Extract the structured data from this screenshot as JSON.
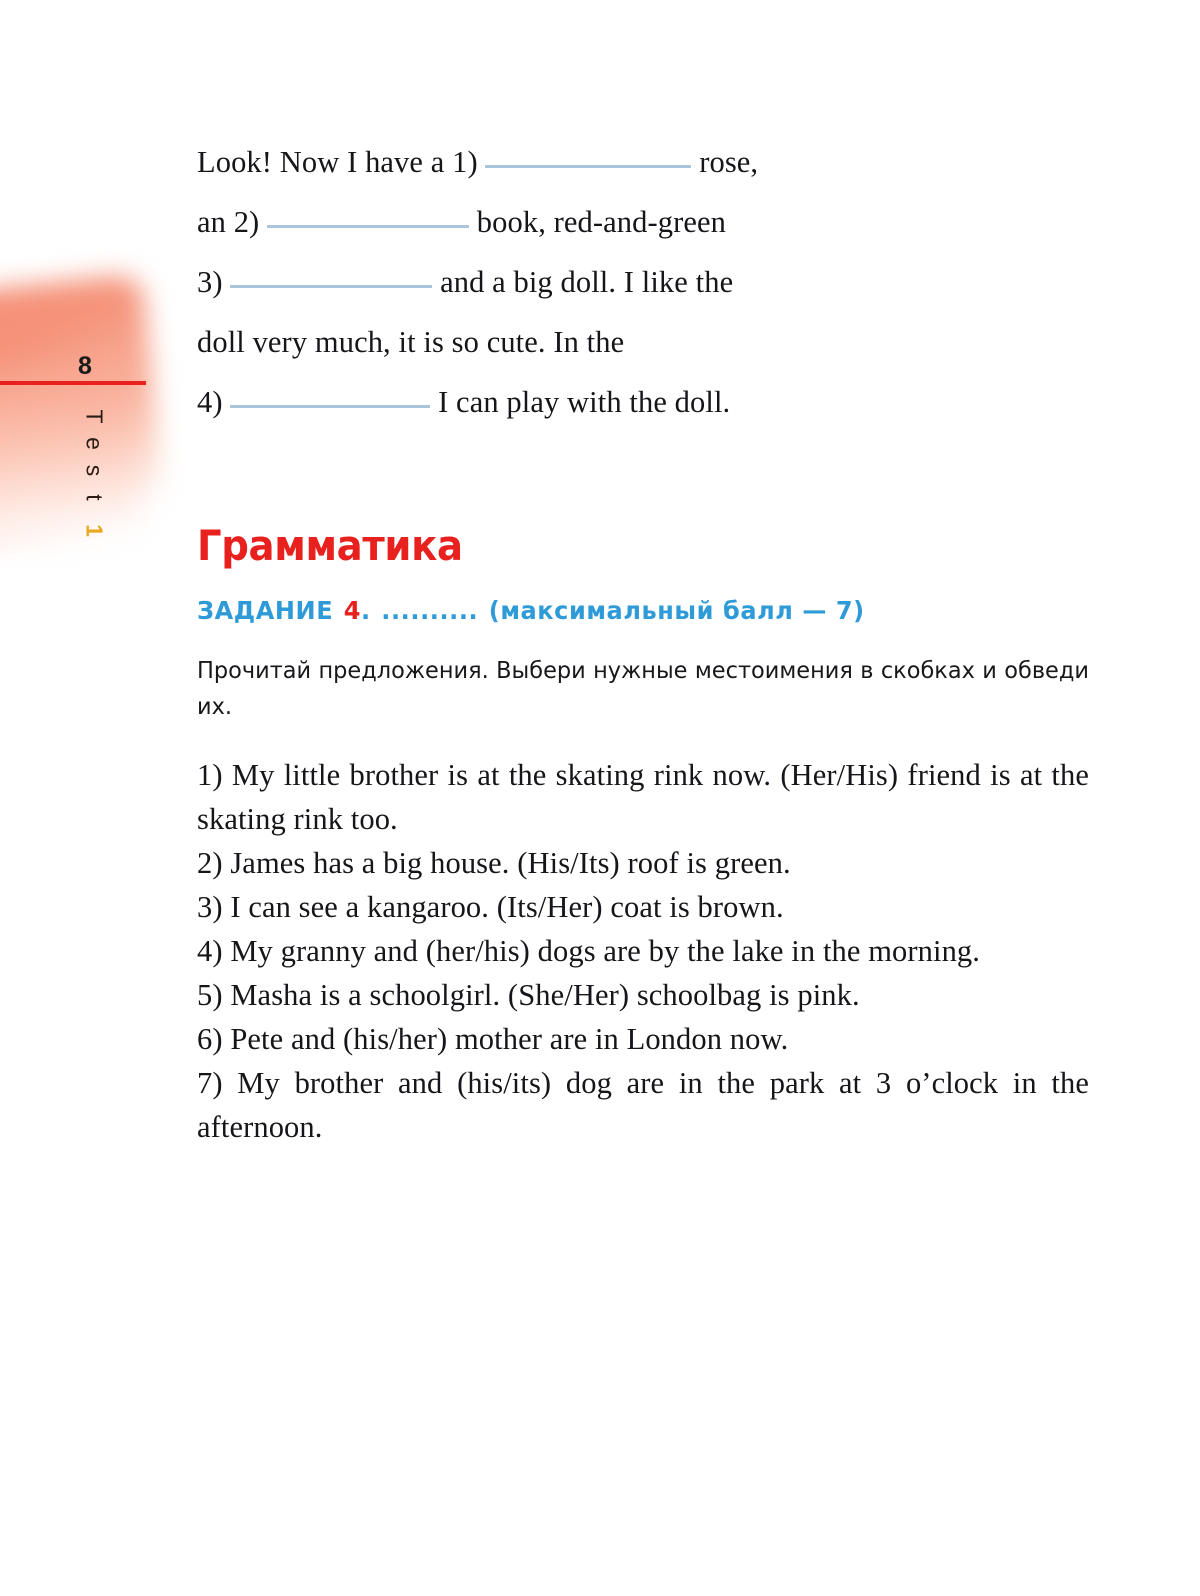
{
  "side_tab": {
    "page_number": "8",
    "label_word": "Test",
    "label_number": "1",
    "rule_color": "#e8201e",
    "number_color": "#e9a81c",
    "blob_color": "#f58d73"
  },
  "cloze": {
    "segments": [
      {
        "type": "text",
        "value": "Look! Now I have a 1)"
      },
      {
        "type": "blank",
        "id": "blank-1"
      },
      {
        "type": "text",
        "value": "rose, an 2)"
      },
      {
        "type": "blank",
        "id": "blank-2"
      },
      {
        "type": "text",
        "value": "book, red-and-green 3)"
      },
      {
        "type": "blank",
        "id": "blank-3"
      },
      {
        "type": "text",
        "value": "and a big doll. I like the doll very much, it is so cute. In the 4)"
      },
      {
        "type": "blank",
        "id": "blank-4"
      },
      {
        "type": "text",
        "value": "I can play with the doll."
      }
    ],
    "line1a": "Look! Now I have a 1)",
    "line1b": "rose,",
    "line2a": "an 2)",
    "line2b": "book, red-and-green",
    "line3a": "3)",
    "line3b": "and a big doll. I like the",
    "line4": "doll very much, it is so cute. In the",
    "line5a": "4)",
    "line5b": "I can play with the doll.",
    "blank_color": "#a9c5d9"
  },
  "grammar_section": {
    "heading": "Грамматика",
    "heading_color": "#e8201e"
  },
  "task": {
    "label": "ЗАДАНИЕ",
    "number": "4",
    "period": ".",
    "dots": "..........",
    "max_score_text": "(максимальный балл — 7)",
    "color": "#2e9bd8",
    "number_color": "#e8201e"
  },
  "instruction": {
    "text": "Прочитай предложения. Выбери нужные местоимения в скобках и обведи их."
  },
  "exercises": {
    "items": [
      "1) My little brother is at the skating rink now. (Her/His) friend is at the skating rink too.",
      "2) James has a big house. (His/Its) roof is green.",
      "3) I can see a kangaroo. (Its/Her) coat is brown.",
      "4) My granny and (her/his) dogs are by the lake in the morning.",
      "5) Masha is a schoolgirl. (She/Her) schoolbag is pink.",
      "6) Pete and (his/her) mother are in London now.",
      "7) My brother and (his/its) dog are in the park at 3 o’clock in the afternoon."
    ]
  }
}
